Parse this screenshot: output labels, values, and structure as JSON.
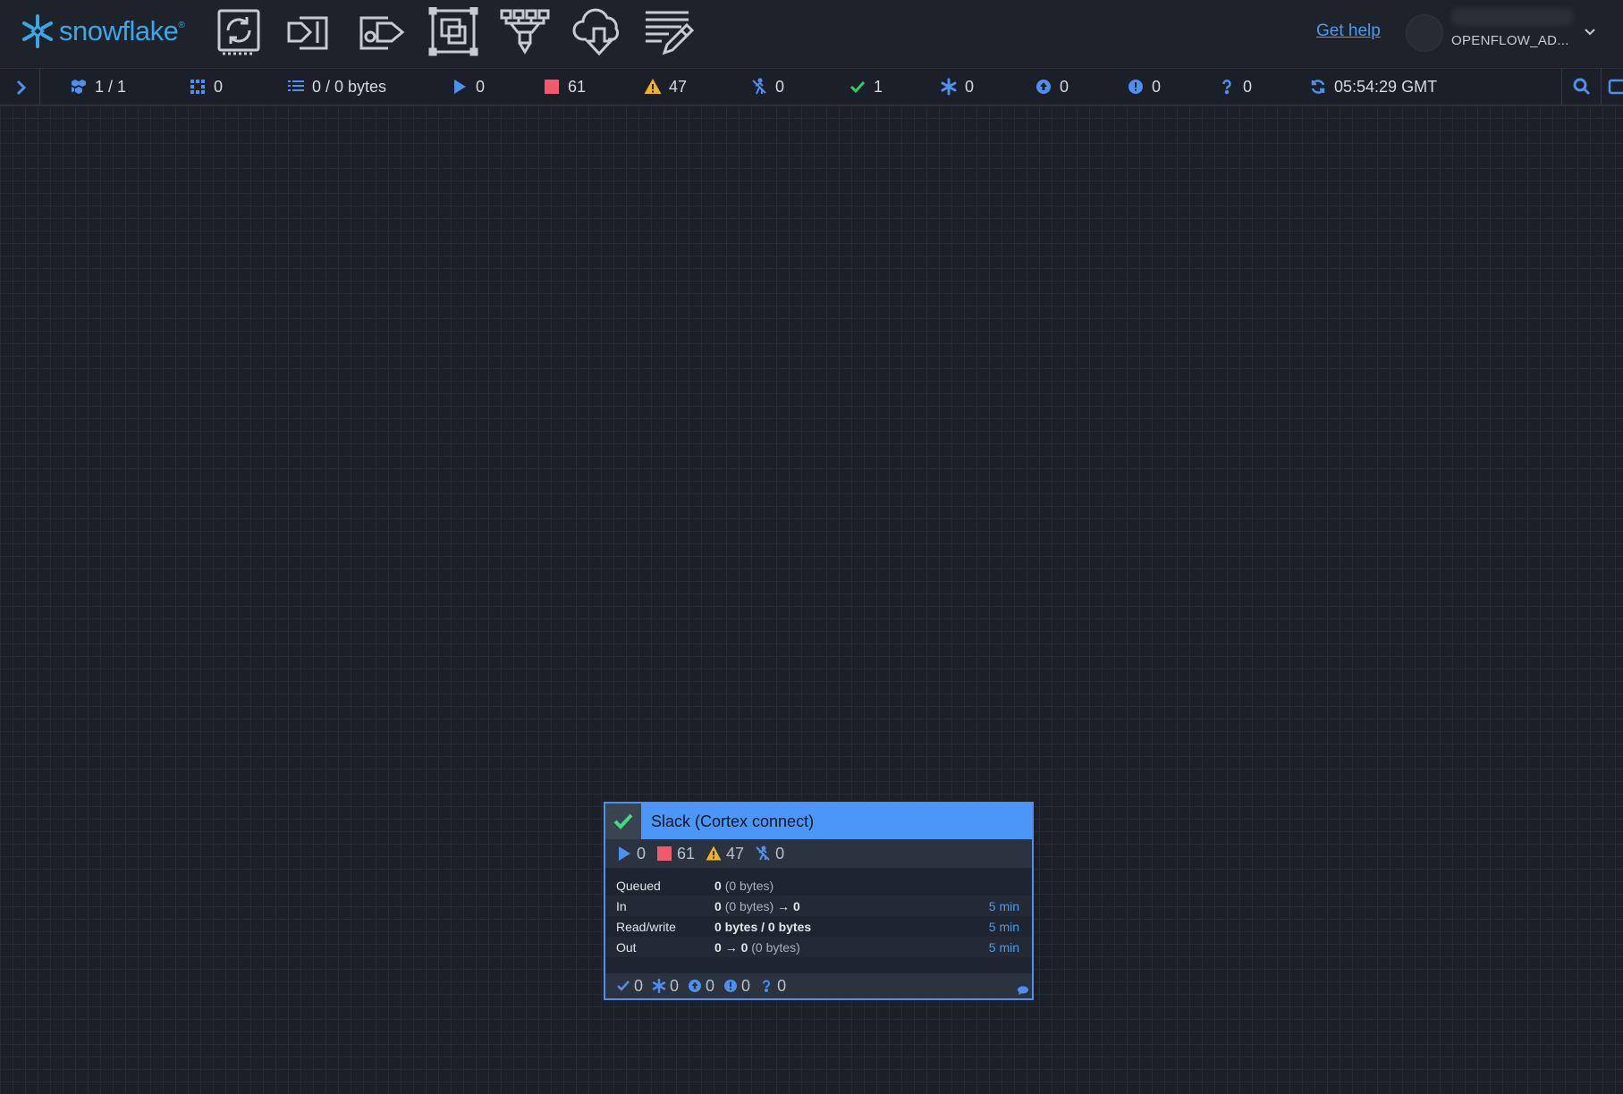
{
  "app": {
    "logo_text": "snowflake",
    "logo_mark": "®",
    "brand_color": "#3aa8e8"
  },
  "toolbar": {
    "tools": [
      {
        "icon": "processor-icon"
      },
      {
        "icon": "input-port-icon"
      },
      {
        "icon": "output-port-icon"
      },
      {
        "icon": "process-group-icon"
      },
      {
        "icon": "funnel-icon"
      },
      {
        "icon": "import-from-registry-icon"
      },
      {
        "icon": "label-icon"
      }
    ]
  },
  "header": {
    "get_help": "Get help",
    "username": "OPENFLOW_AD..."
  },
  "status": {
    "cluster": "1 / 1",
    "threads": "0",
    "queued": "0 / 0 bytes",
    "running": "0",
    "stopped": "61",
    "invalid": "47",
    "disabled": "0",
    "up_to_date": "1",
    "locally_modified": "0",
    "stale": "0",
    "sync_failure": "0",
    "unknown": "0",
    "refreshed": "05:54:29 GMT"
  },
  "process_group": {
    "name": "Slack (Cortex connect)",
    "running": "0",
    "stopped": "61",
    "invalid": "47",
    "disabled": "0",
    "rows": {
      "queued": {
        "label": "Queued",
        "count": "0",
        "size": "(0 bytes)"
      },
      "in": {
        "label": "In",
        "count": "0",
        "size": "(0 bytes)",
        "arrow": "→",
        "target": "0",
        "window": "5 min"
      },
      "readwrite": {
        "label": "Read/write",
        "value": "0 bytes / 0 bytes",
        "window": "5 min"
      },
      "out": {
        "label": "Out",
        "count": "0",
        "arrow": "→",
        "target": "0",
        "size": "(0 bytes)",
        "window": "5 min"
      }
    },
    "footer": {
      "up_to_date": "0",
      "locally_modified": "0",
      "stale": "0",
      "sync_failure": "0",
      "unknown": "0"
    }
  },
  "colors": {
    "accent_blue": "#4c96f7",
    "stopped_red": "#f25a6c",
    "warning_yellow": "#f0b322",
    "success_green": "#2ecc71",
    "status_blue": "#4e8ff0"
  }
}
